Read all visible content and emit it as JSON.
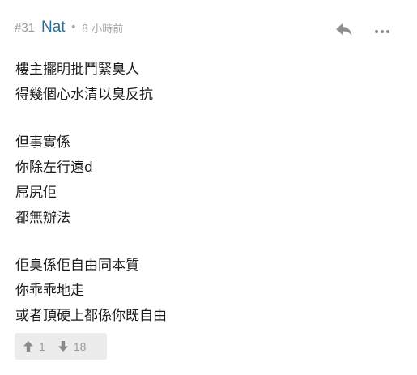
{
  "post": {
    "floor": "#31",
    "username": "Nat",
    "separator": "•",
    "time": "8 小時前",
    "icons": {
      "reply": "reply-icon",
      "more": "more-options-icon",
      "upvote": "arrow-up-icon",
      "downvote": "arrow-down-icon"
    },
    "colors": {
      "username": "#2a6f94",
      "meta": "#9a9a9a",
      "text": "#1c1c1c",
      "vote_bg": "#ececec"
    },
    "paragraphs": [
      [
        "樓主擺明批鬥緊臭人",
        "得幾個心水清以臭反抗"
      ],
      [
        "但事實係",
        "你除左行遠d",
        "屌尻佢",
        "都無辦法"
      ],
      [
        "佢臭係佢自由同本質",
        "你乖乖地走",
        "或者頂硬上都係你既自由"
      ]
    ],
    "votes": {
      "up": "1",
      "down": "18"
    }
  }
}
